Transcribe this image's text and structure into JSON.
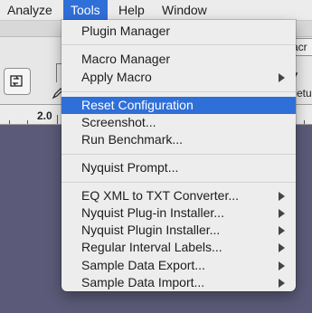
{
  "menubar": {
    "items": [
      {
        "label": "Analyze"
      },
      {
        "label": "Tools"
      },
      {
        "label": "Help"
      },
      {
        "label": "Window"
      }
    ]
  },
  "background": {
    "macro_tab_text": "acr",
    "right_label": "etup",
    "ruler_label": "2.0",
    "toolbar_char": "I"
  },
  "tools_menu": {
    "groups": [
      [
        {
          "label": "Plugin Manager",
          "submenu": false
        }
      ],
      [
        {
          "label": "Macro Manager",
          "submenu": false
        },
        {
          "label": "Apply Macro",
          "submenu": true
        }
      ],
      [
        {
          "label": "Reset Configuration",
          "submenu": false,
          "highlighted": true
        },
        {
          "label": "Screenshot...",
          "submenu": false
        },
        {
          "label": "Run Benchmark...",
          "submenu": false
        }
      ],
      [
        {
          "label": "Nyquist Prompt...",
          "submenu": false
        }
      ],
      [
        {
          "label": "EQ XML to TXT Converter...",
          "submenu": true
        },
        {
          "label": "Nyquist Plug-in Installer...",
          "submenu": true
        },
        {
          "label": "Nyquist Plugin Installer...",
          "submenu": true
        },
        {
          "label": "Regular Interval Labels...",
          "submenu": true
        },
        {
          "label": "Sample Data Export...",
          "submenu": true
        },
        {
          "label": "Sample Data Import...",
          "submenu": true
        }
      ]
    ]
  },
  "colors": {
    "highlight": "#2f6fd8",
    "desktop": "#5b5b79",
    "menu_bg": "#ededed"
  }
}
